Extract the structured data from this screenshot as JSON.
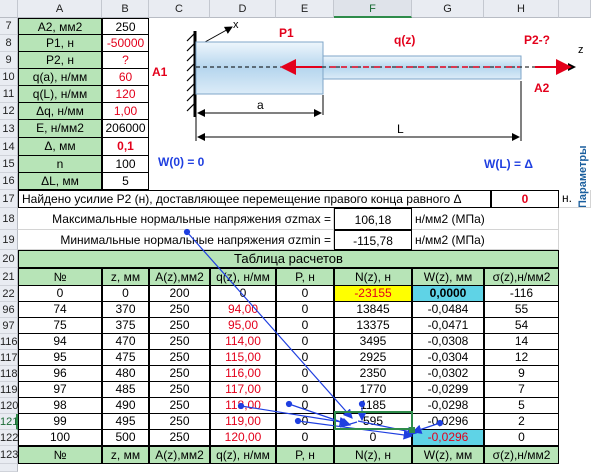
{
  "columns": [
    "A",
    "B",
    "C",
    "D",
    "E",
    "F",
    "G",
    "H"
  ],
  "selected_column": "F",
  "params": [
    {
      "row": "7",
      "label": "A2, мм2",
      "value": "250",
      "value_color": "#000000"
    },
    {
      "row": "8",
      "label": "P1, н",
      "value": "-50000",
      "value_color": "#e3001b"
    },
    {
      "row": "9",
      "label": "P2, н",
      "value": "?",
      "value_color": "#e3001b"
    },
    {
      "row": "10",
      "label": "q(a), н/мм",
      "value": "60",
      "value_color": "#e3001b"
    },
    {
      "row": "11",
      "label": "q(L), н/мм",
      "value": "120",
      "value_color": "#e3001b"
    },
    {
      "row": "12",
      "label": "Δq, н/мм",
      "value": "1,00",
      "value_color": "#e3001b"
    },
    {
      "row": "13",
      "label": "E, н/мм2",
      "value": "206000",
      "value_color": "#000000"
    },
    {
      "row": "14",
      "label": "Δ, мм",
      "value": "0,1",
      "value_color": "#e3001b"
    },
    {
      "row": "15",
      "label": "n",
      "value": "100",
      "value_color": "#000000"
    },
    {
      "row": "16",
      "label": "ΔL, мм",
      "value": "5",
      "value_color": "#000000"
    }
  ],
  "diagram": {
    "x_axis": "x",
    "z_axis": "z",
    "p1": "P1",
    "qz": "q(z)",
    "p2": "P2-?",
    "a1": "A1",
    "a2": "A2",
    "a": "a",
    "L": "L",
    "w0": "W(0) = 0",
    "wl": "W(L) = Δ"
  },
  "row17": {
    "row": "17",
    "text": "Найдено усилие Р2 (н), доставляющее перемещение правого конца равного Δ",
    "value": "0",
    "unit": "н."
  },
  "row18": {
    "row": "18",
    "text": "Максимальные нормальные напряжения σzmax =",
    "value": "106,18",
    "unit": "н/мм2 (МПа)"
  },
  "row19": {
    "row": "19",
    "text": "Минимальные нормальные напряжения σzmin =",
    "value": "-115,78",
    "unit": "н/мм2 (МПа)"
  },
  "table": {
    "title_row": "20",
    "title": "Таблица расчетов",
    "header_row": "21",
    "headers": [
      "№",
      "z, мм",
      "A(z),мм2",
      "q(z), н/мм",
      "P, н",
      "N(z), н",
      "W(z), мм",
      "σ(z),н/мм2"
    ],
    "rows": [
      {
        "row": "22",
        "cells": [
          "0",
          "0",
          "200",
          "0",
          "0",
          "-23155",
          "0,0000",
          "-116"
        ]
      },
      {
        "row": "96",
        "cells": [
          "74",
          "370",
          "250",
          "94,00",
          "0",
          "13845",
          "-0,0484",
          "55"
        ]
      },
      {
        "row": "97",
        "cells": [
          "75",
          "375",
          "250",
          "95,00",
          "0",
          "13375",
          "-0,0471",
          "54"
        ]
      },
      {
        "row": "116",
        "cells": [
          "94",
          "470",
          "250",
          "114,00",
          "0",
          "3495",
          "-0,0308",
          "14"
        ]
      },
      {
        "row": "117",
        "cells": [
          "95",
          "475",
          "250",
          "115,00",
          "0",
          "2925",
          "-0,0304",
          "12"
        ]
      },
      {
        "row": "118",
        "cells": [
          "96",
          "480",
          "250",
          "116,00",
          "0",
          "2350",
          "-0,0302",
          "9"
        ]
      },
      {
        "row": "119",
        "cells": [
          "97",
          "485",
          "250",
          "117,00",
          "0",
          "1770",
          "-0,0299",
          "7"
        ]
      },
      {
        "row": "120",
        "cells": [
          "98",
          "490",
          "250",
          "118,00",
          "0",
          "1185",
          "-0,0298",
          "5"
        ]
      },
      {
        "row": "121",
        "cells": [
          "99",
          "495",
          "250",
          "119,00",
          "0",
          "595",
          "-0,0296",
          "2"
        ]
      },
      {
        "row": "122",
        "cells": [
          "100",
          "500",
          "250",
          "120,00",
          "0",
          "0",
          "-0,0296",
          "0"
        ]
      }
    ],
    "footer_row": "123",
    "footer": [
      "№",
      "z, мм",
      "A(z),мм2",
      "q(z), н/мм",
      "P, н",
      "N(z), н",
      "W(z), мм",
      "σ(z),н/мм2"
    ]
  },
  "side_label": "Параметры",
  "colors": {
    "header_bg": "#e9ecf2",
    "param_green": "#b7e4b7",
    "red_text": "#e3001b",
    "yellow_cell": "#ffff00",
    "cyan_cell": "#5fd3e6",
    "arrow_blue": "#1f3fe0"
  }
}
